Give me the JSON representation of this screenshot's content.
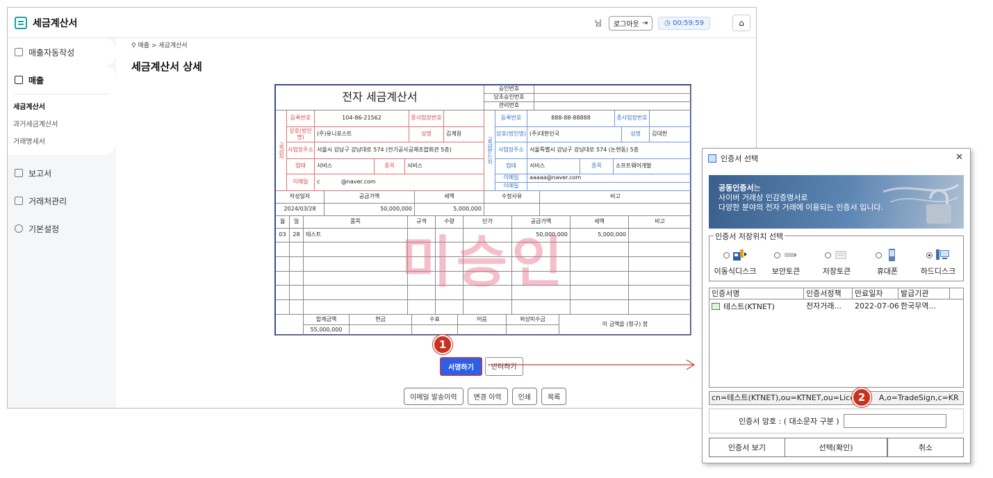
{
  "app": {
    "title": "세금계산서",
    "user_suffix": "님",
    "logout_label": "로그아웃",
    "timer": "00:59:59"
  },
  "sidebar": {
    "top_item": "매출자동작성",
    "section": "매출",
    "subitems": [
      "세금계산서",
      "과거세금계산서",
      "거래명세서"
    ],
    "items": [
      "보고서",
      "거래처관리",
      "기본설정"
    ]
  },
  "breadcrumb": "매출 > 세금계산서",
  "page_title": "세금계산서 상세",
  "invoice": {
    "title": "전자 세금계산서",
    "approval_labels": [
      "승인번호",
      "당초승인번호",
      "관리번호"
    ],
    "supplier_side": "공급자",
    "buyer_side": "공급받는자",
    "labels": {
      "reg_no": "등록번호",
      "sub_biz": "종사업장번호",
      "company": "상호(법인명)",
      "name": "성명",
      "address": "사업장주소",
      "type": "업태",
      "item": "종목",
      "email": "이메일"
    },
    "supplier": {
      "reg_no": "104-86-21562",
      "company": "(주)유니포스트",
      "name": "김계원",
      "address": "서울시 강남구 강남대로 574 (전기공사공제조합회관 5층)",
      "type": "서비스",
      "item": "서비스",
      "email": "c            @naver.com"
    },
    "buyer": {
      "reg_no": "888-88-88888",
      "company": "(주)대한민국",
      "name": "김대한",
      "address": "서울특별시 강남구 강남대로 574 (논현동) 5층",
      "type": "서비스",
      "item": "소프트웨어개발",
      "email": "aaaaa@naver.com",
      "email2": ""
    },
    "summary_headers": [
      "작성일자",
      "공급가액",
      "세액",
      "수정사유",
      "비고"
    ],
    "summary_values": [
      "2024/03/28",
      "50,000,000",
      "5,000,000",
      "",
      ""
    ],
    "item_headers": [
      "월",
      "일",
      "품목",
      "규격",
      "수량",
      "단가",
      "공급가액",
      "세액",
      "비고"
    ],
    "items": [
      [
        "03",
        "28",
        "테스트",
        "",
        "",
        "",
        "50,000,000",
        "5,000,000",
        ""
      ]
    ],
    "total_headers": [
      "합계금액",
      "현금",
      "수표",
      "어음",
      "외상미수금"
    ],
    "total_values": [
      "55,000,000",
      "",
      "",
      "",
      ""
    ],
    "claim_text": "이 금액을 (청구) 함",
    "stamp": "미승인"
  },
  "actions": {
    "sign": "서명하기",
    "reject": "반려하기",
    "email_history": "이메일 발송이력",
    "change_history": "변경 이력",
    "print": "인쇄",
    "list": "목록"
  },
  "badges": [
    "1",
    "2"
  ],
  "dialog": {
    "title": "인증서 선택",
    "banner_bold": "공동인증서",
    "banner_line1_rest": "는",
    "banner_line2": "사이버 거래상 인감증명서로",
    "banner_line3": "다양한 분야의 전자 거래에 이용되는 인증서 입니다.",
    "storage_legend": "인증서 저장위치 선택",
    "storages": [
      "이동식디스크",
      "보안토큰",
      "저장토큰",
      "휴대폰",
      "하드디스크"
    ],
    "columns": [
      "인증서명",
      "인증서정책",
      "만료일자",
      "발급기관"
    ],
    "certs": [
      [
        "테스트(KTNET)",
        "전자거래...",
        "2022-07-06",
        "한국무역..."
      ]
    ],
    "dn": "cn=테스트(KTNET),ou=KTNET,ou=Lice          A,o=TradeSign,c=KR",
    "pw_label": "인증서 암호 : ( 대소문자 구분 )",
    "btn_view": "인증서 보기",
    "btn_ok": "선택(확인)",
    "btn_cancel": "취소"
  }
}
